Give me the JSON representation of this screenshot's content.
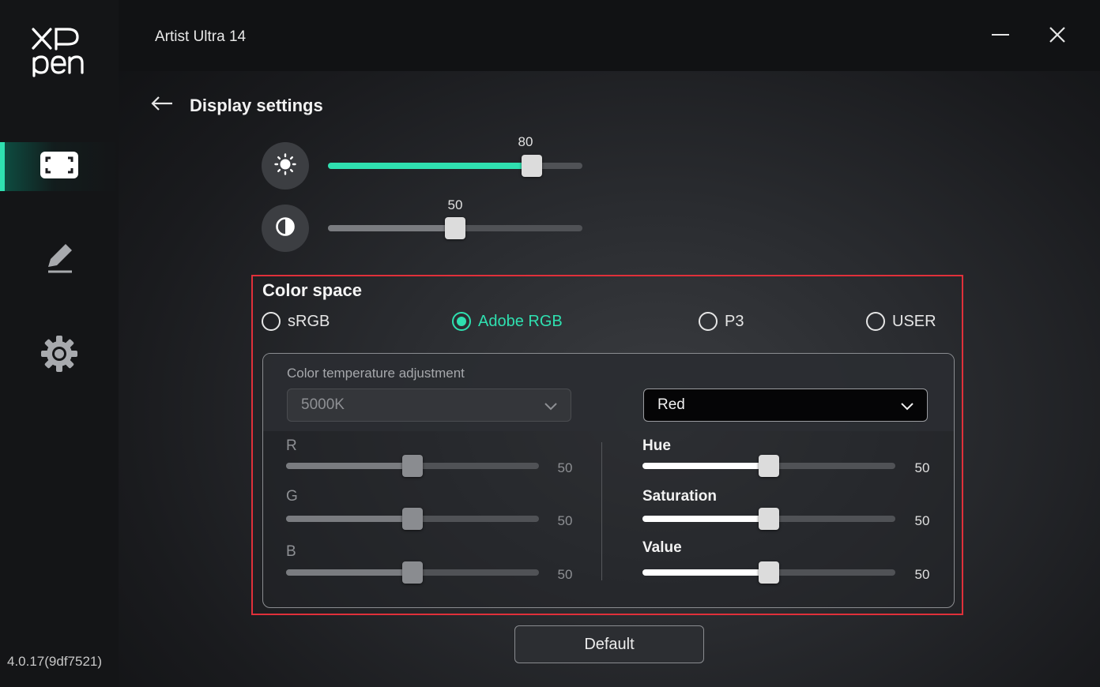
{
  "app": {
    "title": "Artist Ultra 14",
    "version": "4.0.17(9df7521)",
    "accent_color": "#2fe0b0",
    "highlight_color": "#e0303a"
  },
  "sidebar": {
    "items": [
      {
        "name": "display-settings",
        "icon": "fullscreen-frame-icon",
        "active": true
      },
      {
        "name": "pen-settings",
        "icon": "pen-icon",
        "active": false
      },
      {
        "name": "general-settings",
        "icon": "gear-icon",
        "active": false
      }
    ]
  },
  "page": {
    "title": "Display settings"
  },
  "brightness": {
    "icon": "brightness-icon",
    "value": "80",
    "level": 0.8
  },
  "contrast": {
    "icon": "contrast-icon",
    "value": "50",
    "level": 0.5
  },
  "color_space": {
    "title": "Color space",
    "options": [
      {
        "label": "sRGB",
        "selected": false
      },
      {
        "label": "Adobe RGB",
        "selected": true
      },
      {
        "label": "P3",
        "selected": false
      },
      {
        "label": "USER",
        "selected": false
      }
    ]
  },
  "color_temperature": {
    "label": "Color temperature adjustment",
    "value": "5000K",
    "enabled": false
  },
  "color_channel": {
    "value": "Red",
    "enabled": true
  },
  "rgb": [
    {
      "label": "R",
      "value": "50",
      "level": 0.5
    },
    {
      "label": "G",
      "value": "50",
      "level": 0.5
    },
    {
      "label": "B",
      "value": "50",
      "level": 0.5
    }
  ],
  "hsv": [
    {
      "label": "Hue",
      "value": "50",
      "level": 0.5
    },
    {
      "label": "Saturation",
      "value": "50",
      "level": 0.5
    },
    {
      "label": "Value",
      "value": "50",
      "level": 0.5
    }
  ],
  "default_button": "Default"
}
